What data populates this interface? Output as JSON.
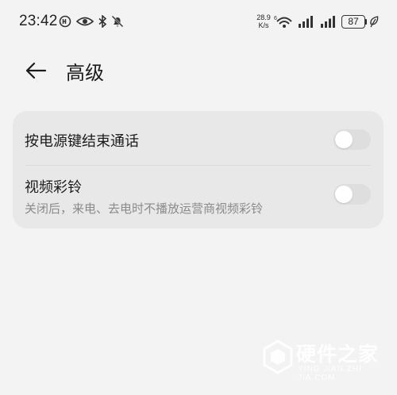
{
  "status_bar": {
    "time": "23:42",
    "net_speed_value": "28.9",
    "net_speed_unit": "K/s",
    "battery_level": "87",
    "icons": [
      "hd-icon",
      "eye-icon",
      "bluetooth-icon",
      "mute-bell-icon",
      "wifi-icon",
      "signal-icon",
      "signal-icon",
      "battery-icon",
      "leaf-icon"
    ]
  },
  "header": {
    "title": "高级"
  },
  "settings": {
    "end_call_label": "按电源键结束通话",
    "end_call_enabled": false,
    "video_ringback_label": "视频彩铃",
    "video_ringback_desc": "关闭后，来电、去电时不播放运营商视频彩铃",
    "video_ringback_enabled": false
  },
  "watermark": {
    "title": "硬件之家",
    "subtitle": "YING JIAN ZHI JIA.COM"
  },
  "colors": {
    "background": "#f3f3f3",
    "card": "#e8e8e8",
    "toggle_off": "#dedede",
    "subtext": "#8a8a8a"
  }
}
